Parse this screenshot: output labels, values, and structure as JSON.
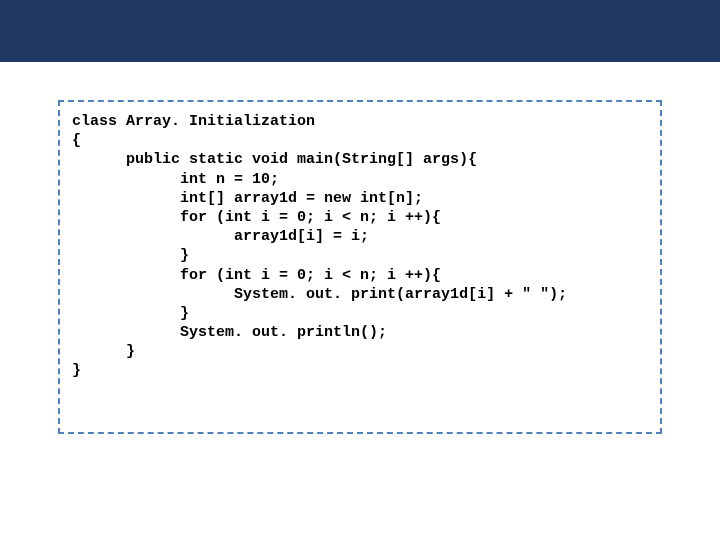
{
  "code": {
    "lines": [
      "class Array. Initialization",
      "{",
      "      public static void main(String[] args){",
      "            int n = 10;",
      "",
      "            int[] array1d = new int[n];",
      "            for (int i = 0; i < n; i ++){",
      "                  array1d[i] = i;",
      "            }",
      "            for (int i = 0; i < n; i ++){",
      "                  System. out. print(array1d[i] + \" \");",
      "            }",
      "            System. out. println();",
      "      }",
      "}"
    ]
  }
}
